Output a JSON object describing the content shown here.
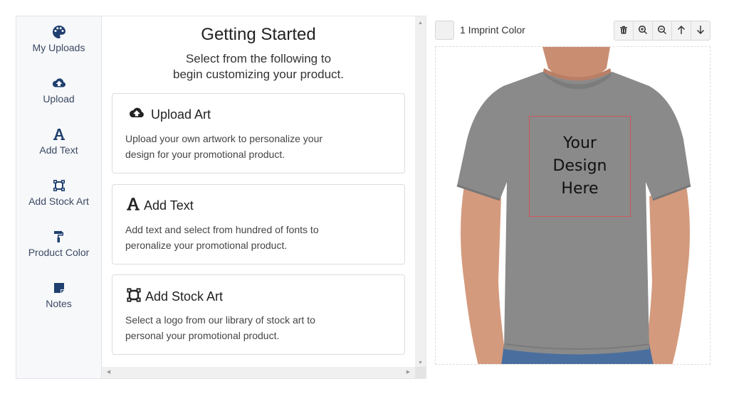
{
  "sidebar": {
    "items": [
      {
        "label": "My Uploads",
        "icon": "palette-icon"
      },
      {
        "label": "Upload",
        "icon": "cloud-upload-icon"
      },
      {
        "label": "Add Text",
        "icon": "font-icon"
      },
      {
        "label": "Add Stock Art",
        "icon": "vector-square-icon"
      },
      {
        "label": "Product Color",
        "icon": "paint-roller-icon"
      },
      {
        "label": "Notes",
        "icon": "sticky-note-icon"
      }
    ]
  },
  "main": {
    "title": "Getting Started",
    "subtitle_line1": "Select from the following to",
    "subtitle_line2": "begin customizing your product.",
    "cards": [
      {
        "title": "Upload Art",
        "icon": "cloud-upload-icon",
        "desc_line1": "Upload your own artwork to personalize your",
        "desc_line2": "design for your promotional product."
      },
      {
        "title": "Add Text",
        "icon": "font-icon",
        "desc_line1": "Add text and select from hundred of fonts to",
        "desc_line2": "peronalize your promotional product."
      },
      {
        "title": "Add Stock Art",
        "icon": "vector-square-icon",
        "desc_line1": "Select a logo from our library of stock art to",
        "desc_line2": "personal your promotional product."
      }
    ]
  },
  "preview": {
    "imprint_label": "1 Imprint Color",
    "toolbar": [
      {
        "name": "delete",
        "icon": "trash-icon"
      },
      {
        "name": "zoom-in",
        "icon": "zoom-in-icon"
      },
      {
        "name": "zoom-out",
        "icon": "zoom-out-icon"
      },
      {
        "name": "move-up",
        "icon": "arrow-up-icon"
      },
      {
        "name": "move-down",
        "icon": "arrow-down-icon"
      }
    ],
    "design_line1": "Your",
    "design_line2": "Design",
    "design_line3": "Here",
    "product": "Gray crew-neck t-shirt",
    "colors": {
      "shirt": "#8a8a8a",
      "design_border": "#d0575b",
      "icon_accent": "#1f3f6e"
    }
  }
}
